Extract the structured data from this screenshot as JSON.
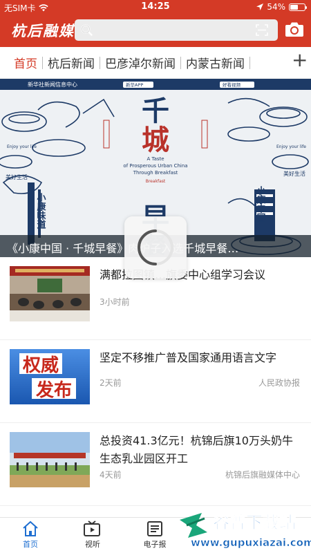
{
  "status_bar": {
    "carrier": "无SIM卡",
    "time": "14:25",
    "battery": "54%",
    "battery_level": 0.54
  },
  "header": {
    "logo": "杭后融媒"
  },
  "tabs": [
    {
      "label": "首页",
      "active": true
    },
    {
      "label": "杭后新闻",
      "active": false
    },
    {
      "label": "巴彦淖尔新闻",
      "active": false
    },
    {
      "label": "内蒙古新闻",
      "active": false
    }
  ],
  "banner": {
    "caption": "《小康中国 · 千城早餐》肉炉子入选千城早餐…",
    "poster_title": "千城早餐",
    "poster_subtitle_en": "A Taste of Prosperous Urban China Through Breakfast",
    "poster_tag": "Breakfast",
    "poster_left": "小康味道",
    "poster_right": "小康中国",
    "poster_small_left": "美好生活",
    "poster_small_right": "美好生活",
    "poster_top_left": "新华社新闻信息中心",
    "poster_top_mid": "新华APP",
    "poster_top_right": "好看视频"
  },
  "news": [
    {
      "title": "满都拉图镇…旗委中心组学习会议",
      "time": "3小时前",
      "source": ""
    },
    {
      "title": "坚定不移推广普及国家通用语言文字",
      "time": "2天前",
      "source": "人民政协报",
      "thumb_text": "权威发布"
    },
    {
      "title": "总投资41.3亿元！杭锦后旗10万头奶牛生态乳业园区开工",
      "time": "4天前",
      "source": "杭锦后旗融媒体中心"
    }
  ],
  "bottom_nav": [
    {
      "label": "首页",
      "icon": "home-icon",
      "active": true
    },
    {
      "label": "视听",
      "icon": "video-icon",
      "active": false
    },
    {
      "label": "电子报",
      "icon": "newspaper-icon",
      "active": false
    }
  ],
  "watermark": {
    "line1": "谷普下载站",
    "line2": "www.gupuxiazai.com"
  },
  "colors": {
    "brand_red": "#d43a26",
    "active_blue": "#1f6fd1"
  }
}
